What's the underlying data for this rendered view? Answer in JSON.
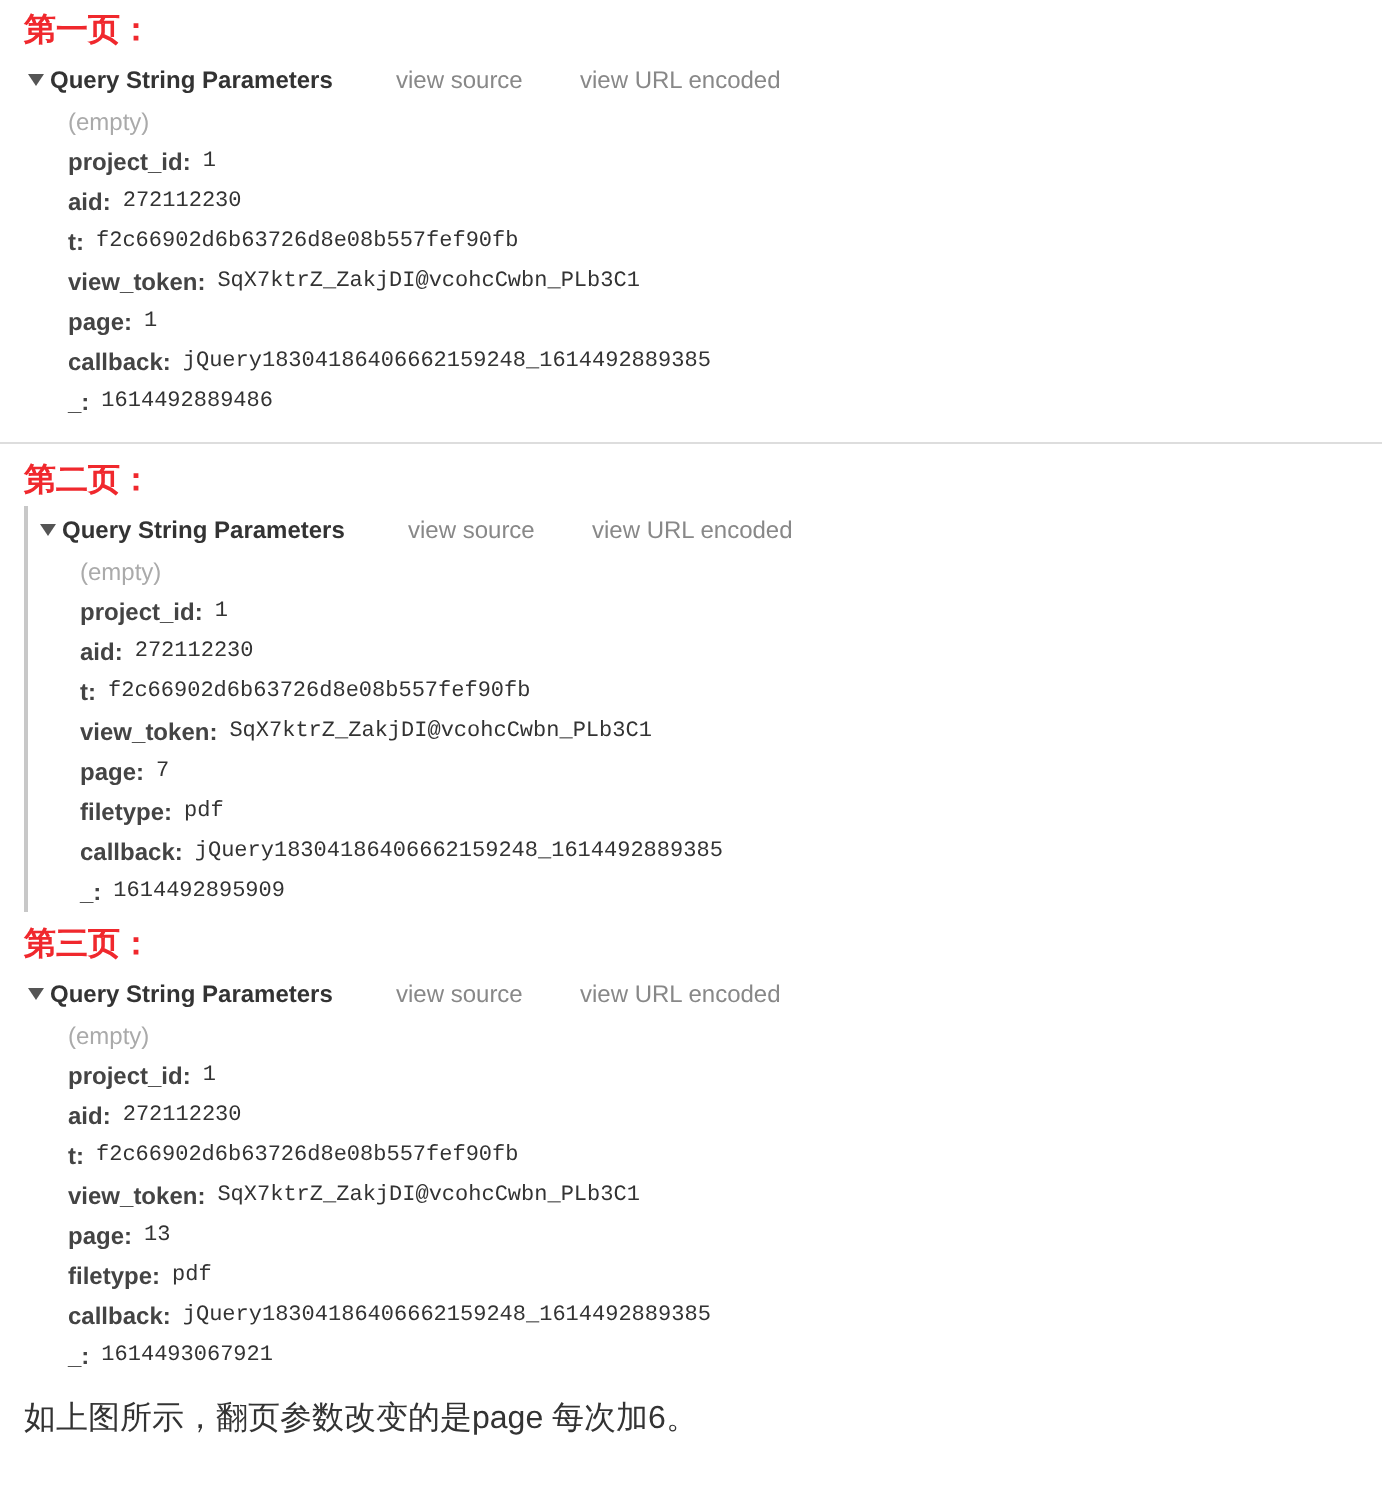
{
  "sections": [
    {
      "heading": "第一页：",
      "kind": "plain",
      "divider_after": true,
      "panel": {
        "title": "Query String Parameters",
        "expanded": true,
        "links": [
          "view source",
          "view URL encoded"
        ],
        "rows": [
          {
            "kind": "empty",
            "text": "(empty)"
          },
          {
            "kind": "param",
            "key": "project_id:",
            "value": "1"
          },
          {
            "kind": "param",
            "key": "aid:",
            "value": "272112230"
          },
          {
            "kind": "param",
            "key": "t:",
            "value": "f2c66902d6b63726d8e08b557fef90fb"
          },
          {
            "kind": "param",
            "key": "view_token:",
            "value": "SqX7ktrZ_ZakjDI@vcohcCwbn_PLb3C1"
          },
          {
            "kind": "param",
            "key": "page:",
            "value": "1"
          },
          {
            "kind": "param",
            "key": "callback:",
            "value": "jQuery18304186406662159248_1614492889385"
          },
          {
            "kind": "param",
            "key": "_:",
            "value": "1614492889486"
          }
        ]
      }
    },
    {
      "heading": "第二页：",
      "kind": "bordered",
      "divider_after": false,
      "panel": {
        "title": "Query String Parameters",
        "expanded": true,
        "links": [
          "view source",
          "view URL encoded"
        ],
        "rows": [
          {
            "kind": "empty",
            "text": "(empty)"
          },
          {
            "kind": "param",
            "key": "project_id:",
            "value": "1"
          },
          {
            "kind": "param",
            "key": "aid:",
            "value": "272112230"
          },
          {
            "kind": "param",
            "key": "t:",
            "value": "f2c66902d6b63726d8e08b557fef90fb"
          },
          {
            "kind": "param",
            "key": "view_token:",
            "value": "SqX7ktrZ_ZakjDI@vcohcCwbn_PLb3C1"
          },
          {
            "kind": "param",
            "key": "page:",
            "value": "7"
          },
          {
            "kind": "param",
            "key": "filetype:",
            "value": "pdf"
          },
          {
            "kind": "param",
            "key": "callback:",
            "value": "jQuery18304186406662159248_1614492889385"
          },
          {
            "kind": "param",
            "key": "_:",
            "value": "1614492895909"
          }
        ]
      }
    },
    {
      "heading": "第三页：",
      "kind": "plain",
      "divider_after": false,
      "panel": {
        "title": "Query String Parameters",
        "expanded": true,
        "links": [
          "view source",
          "view URL encoded"
        ],
        "rows": [
          {
            "kind": "empty",
            "text": "(empty)"
          },
          {
            "kind": "param",
            "key": "project_id:",
            "value": "1"
          },
          {
            "kind": "param",
            "key": "aid:",
            "value": "272112230"
          },
          {
            "kind": "param",
            "key": "t:",
            "value": "f2c66902d6b63726d8e08b557fef90fb"
          },
          {
            "kind": "param",
            "key": "view_token:",
            "value": "SqX7ktrZ_ZakjDI@vcohcCwbn_PLb3C1"
          },
          {
            "kind": "param",
            "key": "page:",
            "value": "13"
          },
          {
            "kind": "param",
            "key": "filetype:",
            "value": "pdf"
          },
          {
            "kind": "param",
            "key": "callback:",
            "value": "jQuery18304186406662159248_1614492889385"
          },
          {
            "kind": "param",
            "key": "_:",
            "value": "1614493067921"
          }
        ]
      }
    }
  ],
  "paragraph": "如上图所示，翻页参数改变的是page 每次加6。"
}
